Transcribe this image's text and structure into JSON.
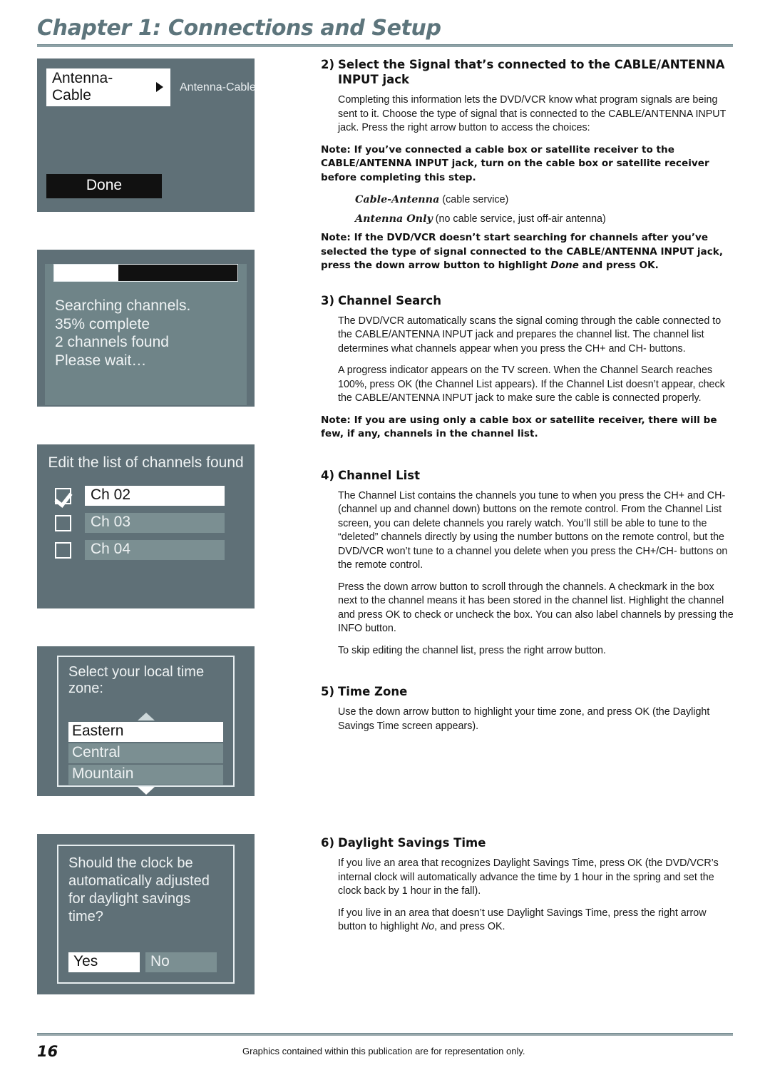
{
  "header": {
    "chapter_title": "Chapter 1: Connections and Setup"
  },
  "screens": {
    "antenna_select": {
      "field_value": "Antenna-Cable",
      "side_label": "Antenna-Cable",
      "done_label": "Done"
    },
    "channel_search": {
      "progress_percent": 35,
      "line1": "Searching channels.",
      "line2": "35% complete",
      "line3": "2 channels found",
      "line4": "Please wait…"
    },
    "channel_list": {
      "title": "Edit the list of channels found",
      "rows": [
        {
          "label": "Ch 02",
          "checked": true,
          "selected": true
        },
        {
          "label": "Ch 03",
          "checked": false,
          "selected": false
        },
        {
          "label": "Ch 04",
          "checked": false,
          "selected": false
        }
      ]
    },
    "time_zone": {
      "title": "Select your local time zone:",
      "options": [
        {
          "label": "Eastern",
          "selected": true
        },
        {
          "label": "Central",
          "selected": false
        },
        {
          "label": "Mountain",
          "selected": false
        }
      ]
    },
    "daylight_savings": {
      "question": "Should the clock be automatically adjusted for daylight savings time?",
      "yes_label": "Yes",
      "no_label": "No"
    }
  },
  "sections": {
    "s2": {
      "number": "2)",
      "title": "Select the Signal that’s connected to the CABLE/ANTENNA INPUT jack",
      "p1": "Completing this information lets the DVD/VCR know what program signals are being sent to it. Choose the type of signal that is connected to the CABLE/ANTENNA INPUT jack. Press the right arrow button to access the choices:",
      "note1": "Note: If you’ve connected a cable box or satellite receiver to the CABLE/ANTENNA INPUT jack, turn on the cable box or satellite receiver before completing this step.",
      "choice1_bold": "Cable-Antenna",
      "choice1_rest": "(cable service)",
      "choice2_bold": "Antenna Only",
      "choice2_rest": "(no cable service, just off-air antenna)",
      "note2_a": "Note: If the DVD/VCR doesn’t start searching for channels after you’ve selected the type of signal connected to the CABLE/ANTENNA INPUT jack, press the down arrow button to highlight ",
      "note2_ital": "Done",
      "note2_b": " and press OK."
    },
    "s3": {
      "number": "3)",
      "title": "Channel Search",
      "p1": "The DVD/VCR automatically scans the signal coming through the cable connected to the CABLE/ANTENNA INPUT jack and prepares the channel list. The channel list determines what channels appear when you press the CH+ and CH- buttons.",
      "p2": "A progress indicator appears on the TV screen. When the Channel Search reaches 100%, press OK (the Channel List appears). If the Channel List doesn’t appear, check the CABLE/ANTENNA INPUT jack to make sure the cable is connected properly.",
      "note1": "Note: If you are using only a cable box or satellite receiver, there will be few, if any, channels in the channel list."
    },
    "s4": {
      "number": "4)",
      "title": "Channel List",
      "p1": "The Channel List contains the channels you tune to when you press the CH+ and CH- (channel up and channel down) buttons on the remote control. From the Channel List screen, you can delete channels you rarely watch. You’ll still be able to tune to the “deleted” channels directly by using the number buttons on the remote control, but the DVD/VCR won’t tune to a channel you delete when you press the CH+/CH- buttons on the remote control.",
      "p2": "Press the down arrow button to scroll through the channels. A checkmark in the box next to the channel means it has been stored in the channel list. Highlight the channel and press OK to check or uncheck the box. You can also label channels by pressing the INFO button.",
      "p3": "To skip editing the channel list, press the right arrow button."
    },
    "s5": {
      "number": "5)",
      "title": "Time Zone",
      "p1": "Use the down arrow button to highlight your time zone, and press OK (the Daylight Savings Time screen appears)."
    },
    "s6": {
      "number": "6)",
      "title": "Daylight Savings Time",
      "p1": "If you live an area that recognizes Daylight Savings Time, press OK (the DVD/VCR’s internal clock will automatically advance the time by 1 hour in the spring and set the clock back by 1 hour in the fall).",
      "p2_a": "If you live in an area that doesn’t use Daylight Savings Time, press the right arrow button to highlight ",
      "p2_ital": "No",
      "p2_b": ", and press OK."
    }
  },
  "footer": {
    "page_number": "16",
    "note": "Graphics contained within this publication are for representation only."
  },
  "colors": {
    "chapter_title": "#5d757c",
    "screen_bg": "#5f7077",
    "screen_inner_bg": "#6f8488",
    "osd_unselected": "#7b8f92"
  }
}
